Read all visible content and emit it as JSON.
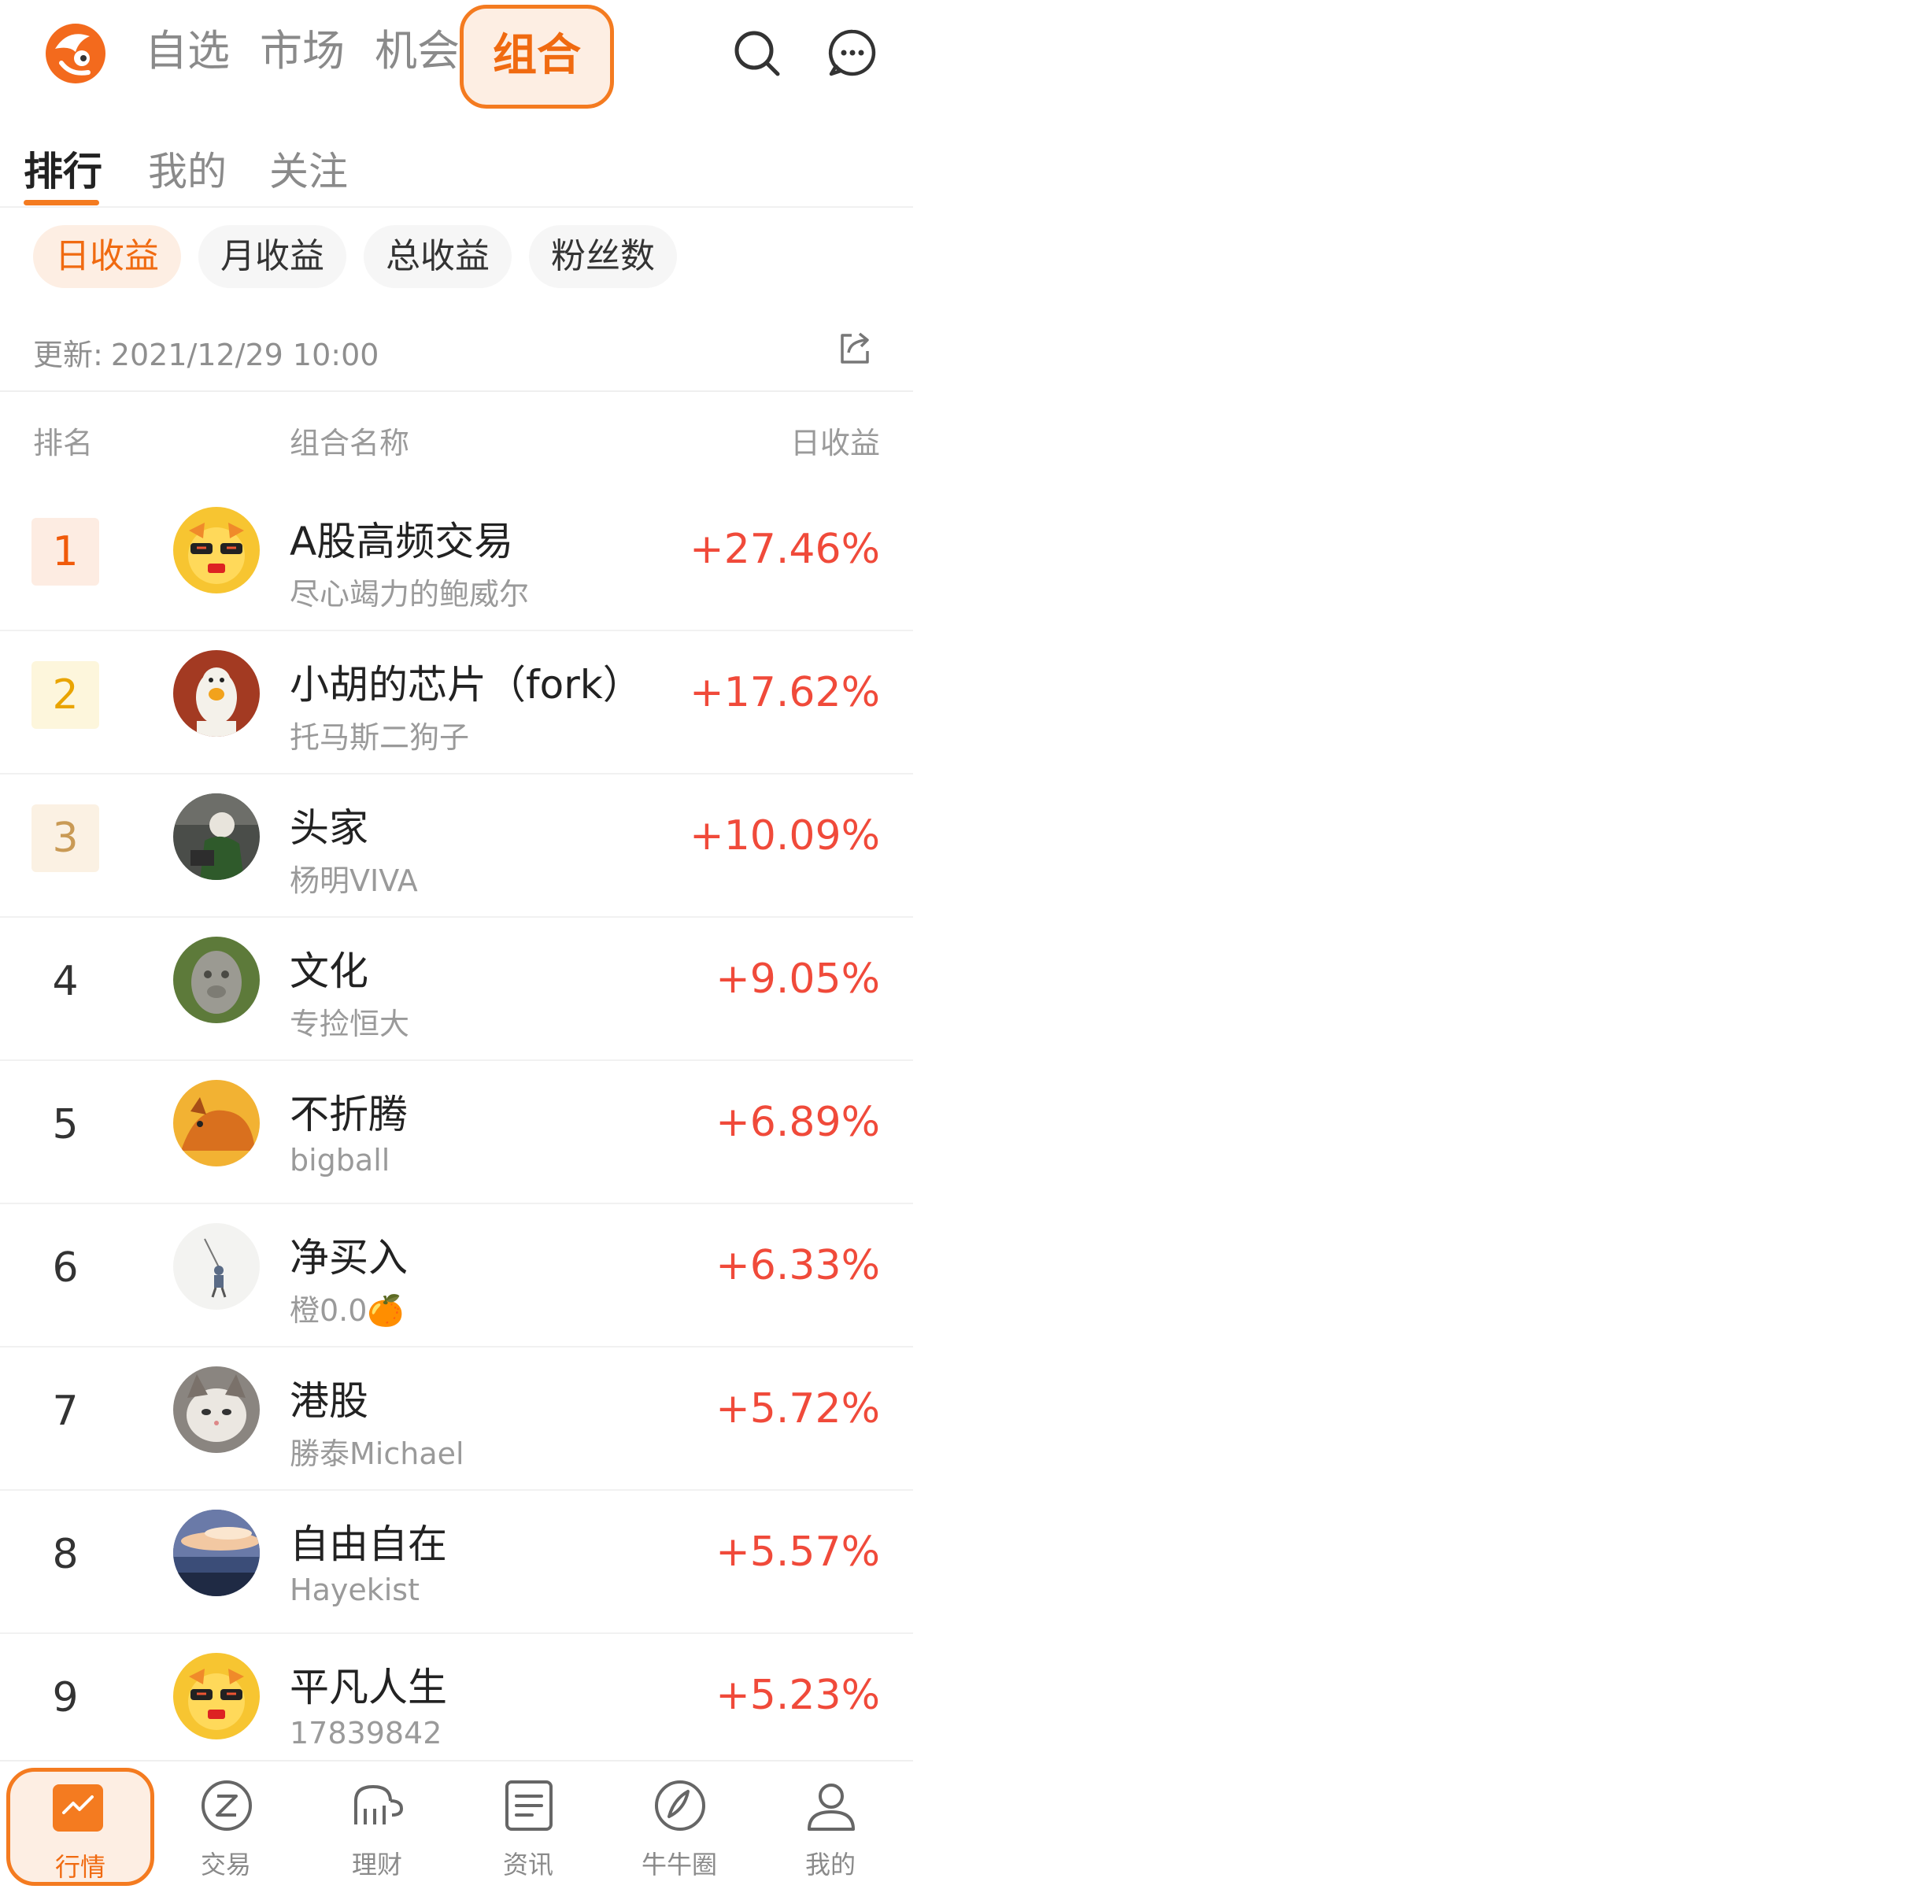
{
  "top_nav": {
    "tabs": [
      "自选",
      "市场",
      "机会",
      "组合"
    ],
    "active_tab": "组合"
  },
  "sub_tabs": [
    "排行",
    "我的",
    "关注"
  ],
  "filters": [
    "日收益",
    "月收益",
    "总收益",
    "粉丝数"
  ],
  "update": {
    "label": "更新:",
    "time": "2021/12/29 10:00"
  },
  "columns": {
    "rank": "排名",
    "name": "组合名称",
    "gain": "日收益"
  },
  "rows": [
    {
      "rank": "1",
      "name": "A股高频交易",
      "owner": "尽心竭力的鲍威尔",
      "gain": "+27.46%"
    },
    {
      "rank": "2",
      "name": "小胡的芯片（fork）",
      "owner": "托马斯二狗子",
      "gain": "+17.62%"
    },
    {
      "rank": "3",
      "name": "头家",
      "owner": "杨明VIVA",
      "gain": "+10.09%"
    },
    {
      "rank": "4",
      "name": "文化",
      "owner": "专捡恒大",
      "gain": "+9.05%"
    },
    {
      "rank": "5",
      "name": "不折腾",
      "owner": "bigball",
      "gain": "+6.89%"
    },
    {
      "rank": "6",
      "name": "净买入",
      "owner": "橙0.0🍊",
      "gain": "+6.33%"
    },
    {
      "rank": "7",
      "name": "港股",
      "owner": "勝泰Michael",
      "gain": "+5.72%"
    },
    {
      "rank": "8",
      "name": "自由自在",
      "owner": "Hayekist",
      "gain": "+5.57%"
    },
    {
      "rank": "9",
      "name": "平凡人生",
      "owner": "17839842",
      "gain": "+5.23%"
    }
  ],
  "tab_bar": [
    {
      "label": "行情",
      "icon": "chart-icon"
    },
    {
      "label": "交易",
      "icon": "trade-icon"
    },
    {
      "label": "理财",
      "icon": "wealth-icon"
    },
    {
      "label": "资讯",
      "icon": "news-icon"
    },
    {
      "label": "牛牛圈",
      "icon": "community-icon"
    },
    {
      "label": "我的",
      "icon": "profile-icon"
    }
  ],
  "colors": {
    "accent": "#f47b20",
    "gain": "#f04a3a",
    "rank1": "#f05a0a",
    "rank2": "#e9a400",
    "rank3": "#c99a55"
  }
}
